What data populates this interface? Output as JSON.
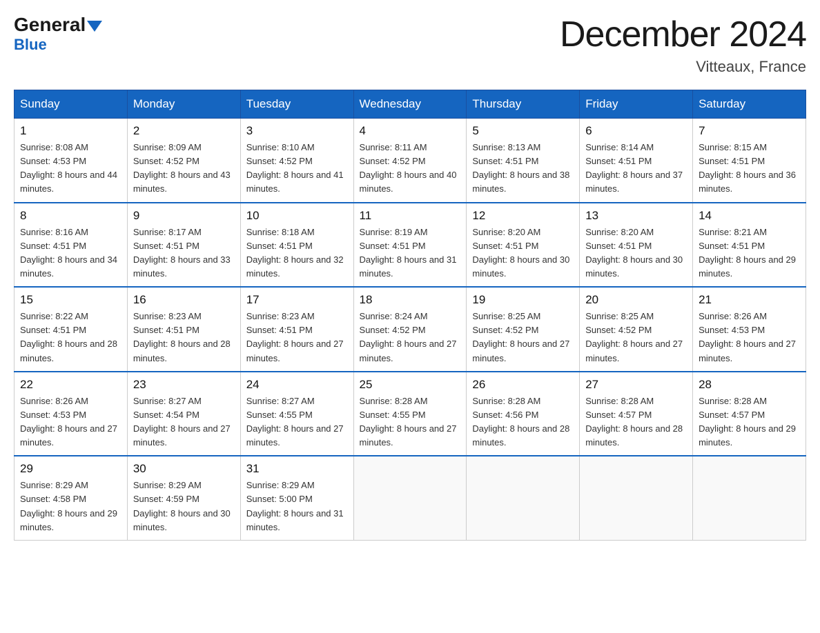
{
  "header": {
    "logo": {
      "general": "General",
      "blue": "Blue",
      "triangle": "▼"
    },
    "title": "December 2024",
    "location": "Vitteaux, France"
  },
  "weekdays": [
    "Sunday",
    "Monday",
    "Tuesday",
    "Wednesday",
    "Thursday",
    "Friday",
    "Saturday"
  ],
  "weeks": [
    [
      {
        "day": "1",
        "sunrise": "8:08 AM",
        "sunset": "4:53 PM",
        "daylight": "8 hours and 44 minutes."
      },
      {
        "day": "2",
        "sunrise": "8:09 AM",
        "sunset": "4:52 PM",
        "daylight": "8 hours and 43 minutes."
      },
      {
        "day": "3",
        "sunrise": "8:10 AM",
        "sunset": "4:52 PM",
        "daylight": "8 hours and 41 minutes."
      },
      {
        "day": "4",
        "sunrise": "8:11 AM",
        "sunset": "4:52 PM",
        "daylight": "8 hours and 40 minutes."
      },
      {
        "day": "5",
        "sunrise": "8:13 AM",
        "sunset": "4:51 PM",
        "daylight": "8 hours and 38 minutes."
      },
      {
        "day": "6",
        "sunrise": "8:14 AM",
        "sunset": "4:51 PM",
        "daylight": "8 hours and 37 minutes."
      },
      {
        "day": "7",
        "sunrise": "8:15 AM",
        "sunset": "4:51 PM",
        "daylight": "8 hours and 36 minutes."
      }
    ],
    [
      {
        "day": "8",
        "sunrise": "8:16 AM",
        "sunset": "4:51 PM",
        "daylight": "8 hours and 34 minutes."
      },
      {
        "day": "9",
        "sunrise": "8:17 AM",
        "sunset": "4:51 PM",
        "daylight": "8 hours and 33 minutes."
      },
      {
        "day": "10",
        "sunrise": "8:18 AM",
        "sunset": "4:51 PM",
        "daylight": "8 hours and 32 minutes."
      },
      {
        "day": "11",
        "sunrise": "8:19 AM",
        "sunset": "4:51 PM",
        "daylight": "8 hours and 31 minutes."
      },
      {
        "day": "12",
        "sunrise": "8:20 AM",
        "sunset": "4:51 PM",
        "daylight": "8 hours and 30 minutes."
      },
      {
        "day": "13",
        "sunrise": "8:20 AM",
        "sunset": "4:51 PM",
        "daylight": "8 hours and 30 minutes."
      },
      {
        "day": "14",
        "sunrise": "8:21 AM",
        "sunset": "4:51 PM",
        "daylight": "8 hours and 29 minutes."
      }
    ],
    [
      {
        "day": "15",
        "sunrise": "8:22 AM",
        "sunset": "4:51 PM",
        "daylight": "8 hours and 28 minutes."
      },
      {
        "day": "16",
        "sunrise": "8:23 AM",
        "sunset": "4:51 PM",
        "daylight": "8 hours and 28 minutes."
      },
      {
        "day": "17",
        "sunrise": "8:23 AM",
        "sunset": "4:51 PM",
        "daylight": "8 hours and 27 minutes."
      },
      {
        "day": "18",
        "sunrise": "8:24 AM",
        "sunset": "4:52 PM",
        "daylight": "8 hours and 27 minutes."
      },
      {
        "day": "19",
        "sunrise": "8:25 AM",
        "sunset": "4:52 PM",
        "daylight": "8 hours and 27 minutes."
      },
      {
        "day": "20",
        "sunrise": "8:25 AM",
        "sunset": "4:52 PM",
        "daylight": "8 hours and 27 minutes."
      },
      {
        "day": "21",
        "sunrise": "8:26 AM",
        "sunset": "4:53 PM",
        "daylight": "8 hours and 27 minutes."
      }
    ],
    [
      {
        "day": "22",
        "sunrise": "8:26 AM",
        "sunset": "4:53 PM",
        "daylight": "8 hours and 27 minutes."
      },
      {
        "day": "23",
        "sunrise": "8:27 AM",
        "sunset": "4:54 PM",
        "daylight": "8 hours and 27 minutes."
      },
      {
        "day": "24",
        "sunrise": "8:27 AM",
        "sunset": "4:55 PM",
        "daylight": "8 hours and 27 minutes."
      },
      {
        "day": "25",
        "sunrise": "8:28 AM",
        "sunset": "4:55 PM",
        "daylight": "8 hours and 27 minutes."
      },
      {
        "day": "26",
        "sunrise": "8:28 AM",
        "sunset": "4:56 PM",
        "daylight": "8 hours and 28 minutes."
      },
      {
        "day": "27",
        "sunrise": "8:28 AM",
        "sunset": "4:57 PM",
        "daylight": "8 hours and 28 minutes."
      },
      {
        "day": "28",
        "sunrise": "8:28 AM",
        "sunset": "4:57 PM",
        "daylight": "8 hours and 29 minutes."
      }
    ],
    [
      {
        "day": "29",
        "sunrise": "8:29 AM",
        "sunset": "4:58 PM",
        "daylight": "8 hours and 29 minutes."
      },
      {
        "day": "30",
        "sunrise": "8:29 AM",
        "sunset": "4:59 PM",
        "daylight": "8 hours and 30 minutes."
      },
      {
        "day": "31",
        "sunrise": "8:29 AM",
        "sunset": "5:00 PM",
        "daylight": "8 hours and 31 minutes."
      },
      null,
      null,
      null,
      null
    ]
  ]
}
